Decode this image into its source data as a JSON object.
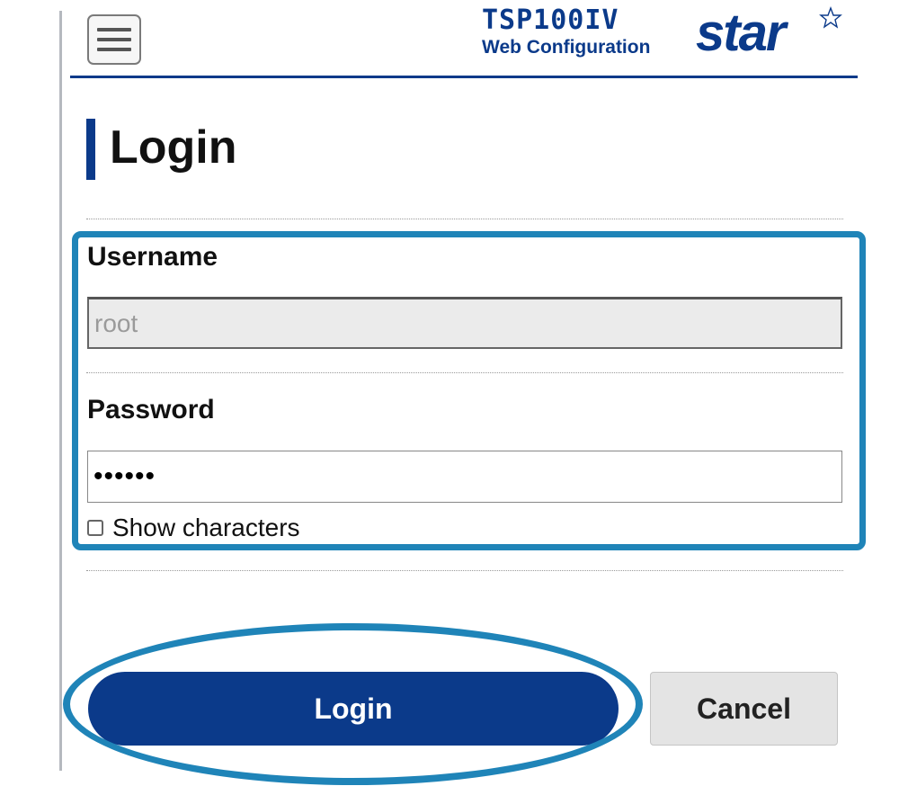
{
  "header": {
    "model": "TSP100IV",
    "subtitle": "Web Configuration",
    "logo_text": "star",
    "menu_icon": "hamburger-menu-icon",
    "brand_color": "#0b3a8a"
  },
  "page": {
    "title": "Login"
  },
  "form": {
    "username": {
      "label": "Username",
      "value": "root",
      "disabled": true
    },
    "password": {
      "label": "Password",
      "value": "••••••",
      "type": "password"
    },
    "show_characters": {
      "label": "Show characters",
      "checked": false
    }
  },
  "actions": {
    "login_label": "Login",
    "cancel_label": "Cancel"
  },
  "highlight_color": "#1f84b8"
}
